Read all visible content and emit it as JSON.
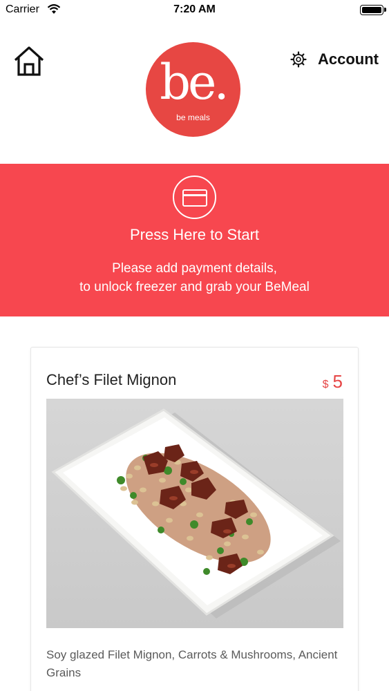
{
  "status_bar": {
    "carrier": "Carrier",
    "time": "7:20 AM"
  },
  "header": {
    "home_icon": "home-icon",
    "logo_mark": "be.",
    "logo_subtitle": "be meals",
    "account_icon": "gear-icon",
    "account_label": "Account"
  },
  "banner": {
    "icon": "credit-card-icon",
    "title": "Press Here to Start",
    "line1": "Please add payment details,",
    "line2": "to unlock freezer and grab your BeMeal",
    "background": "#f7474f"
  },
  "meal": {
    "name": "Chef’s Filet Mignon",
    "currency": "$",
    "price": "5",
    "description": "Soy glazed Filet Mignon, Carrots & Mushrooms, Ancient Grains"
  },
  "colors": {
    "brand_red": "#e74743",
    "price_red": "#e64545"
  }
}
